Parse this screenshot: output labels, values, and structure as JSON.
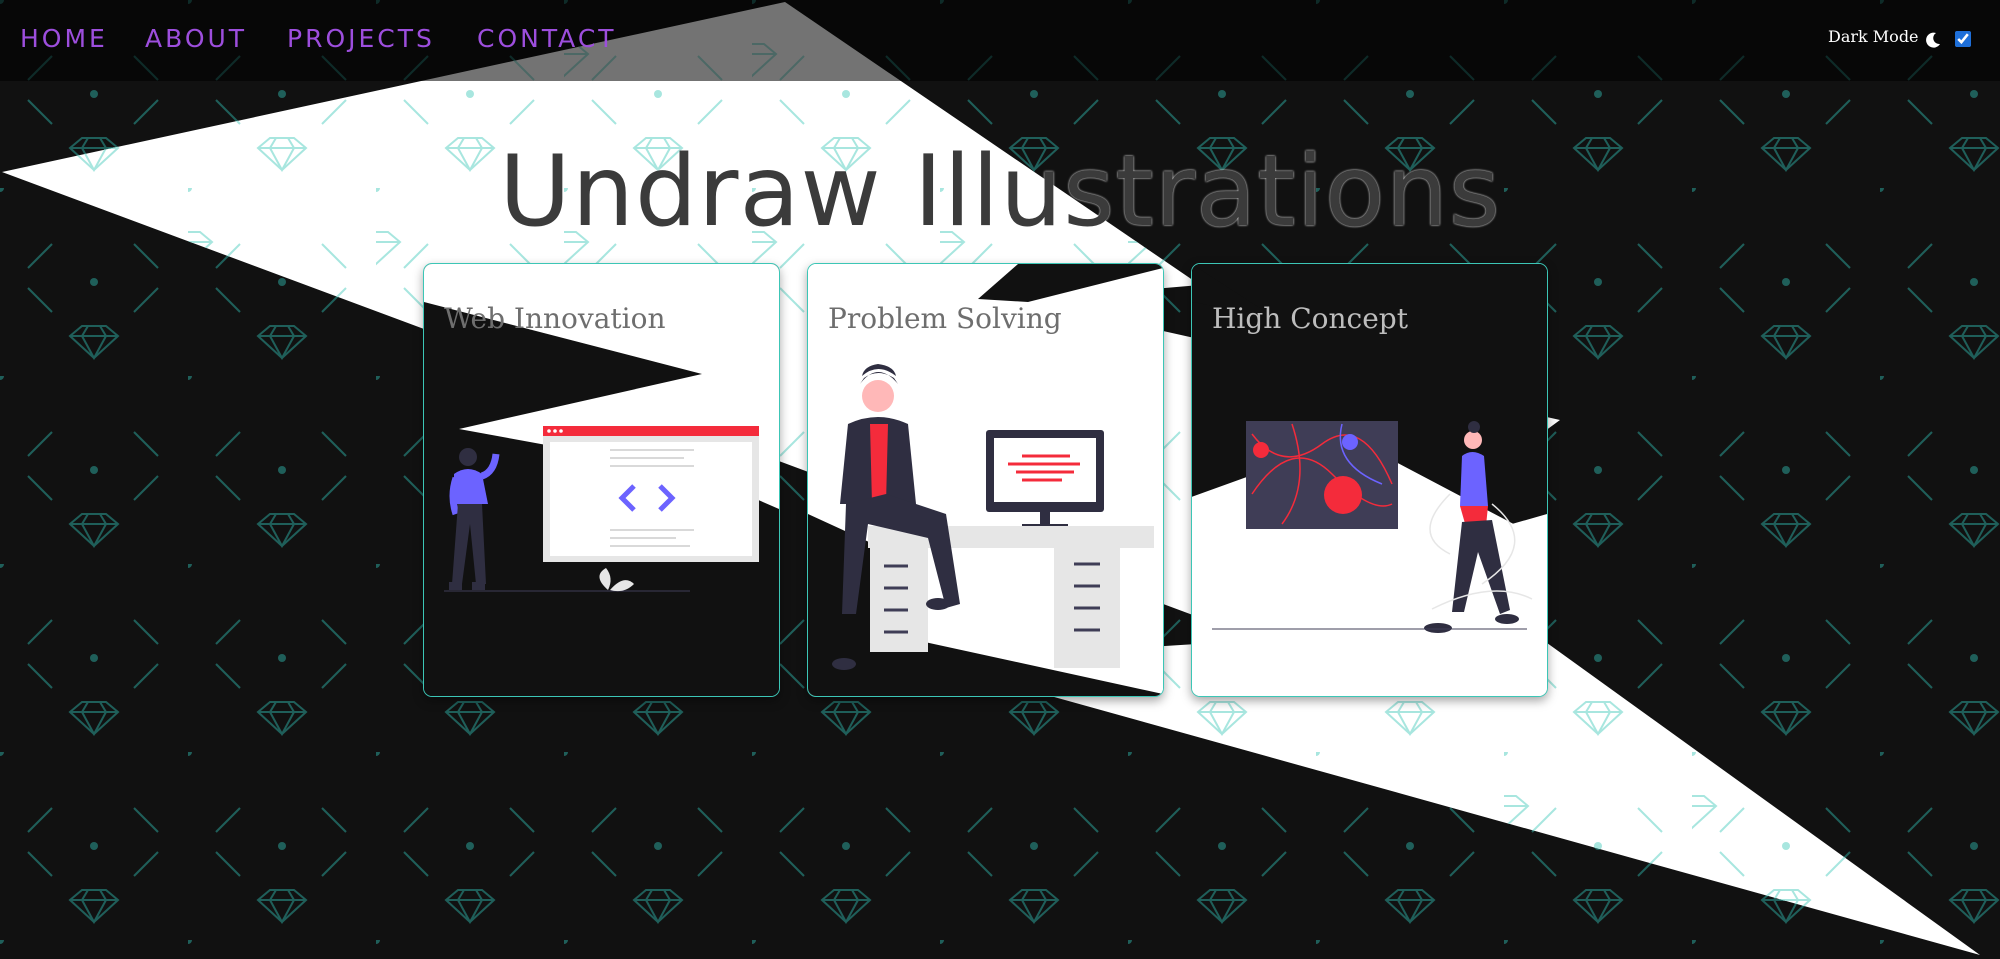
{
  "nav": {
    "links": [
      "HOME",
      "ABOUT",
      "PROJECTS",
      "CONTACT"
    ]
  },
  "dark_mode": {
    "label": "Dark Mode",
    "checked": true,
    "icon": "moon-icon"
  },
  "hero": {
    "title": "Undraw Illustrations"
  },
  "cards": [
    {
      "title": "Web Innovation",
      "illustration": "web-developer-illustration"
    },
    {
      "title": "Problem Solving",
      "illustration": "developer-at-desk-illustration"
    },
    {
      "title": "High Concept",
      "illustration": "abstract-art-illustration"
    }
  ],
  "colors": {
    "accent_link": "#9d4edd",
    "card_border": "#3cc6b6",
    "background_dark": "#111111",
    "pattern_teal": "#1f5f5a",
    "illustration_purple": "#6c63ff",
    "illustration_red": "#f42b3b"
  }
}
